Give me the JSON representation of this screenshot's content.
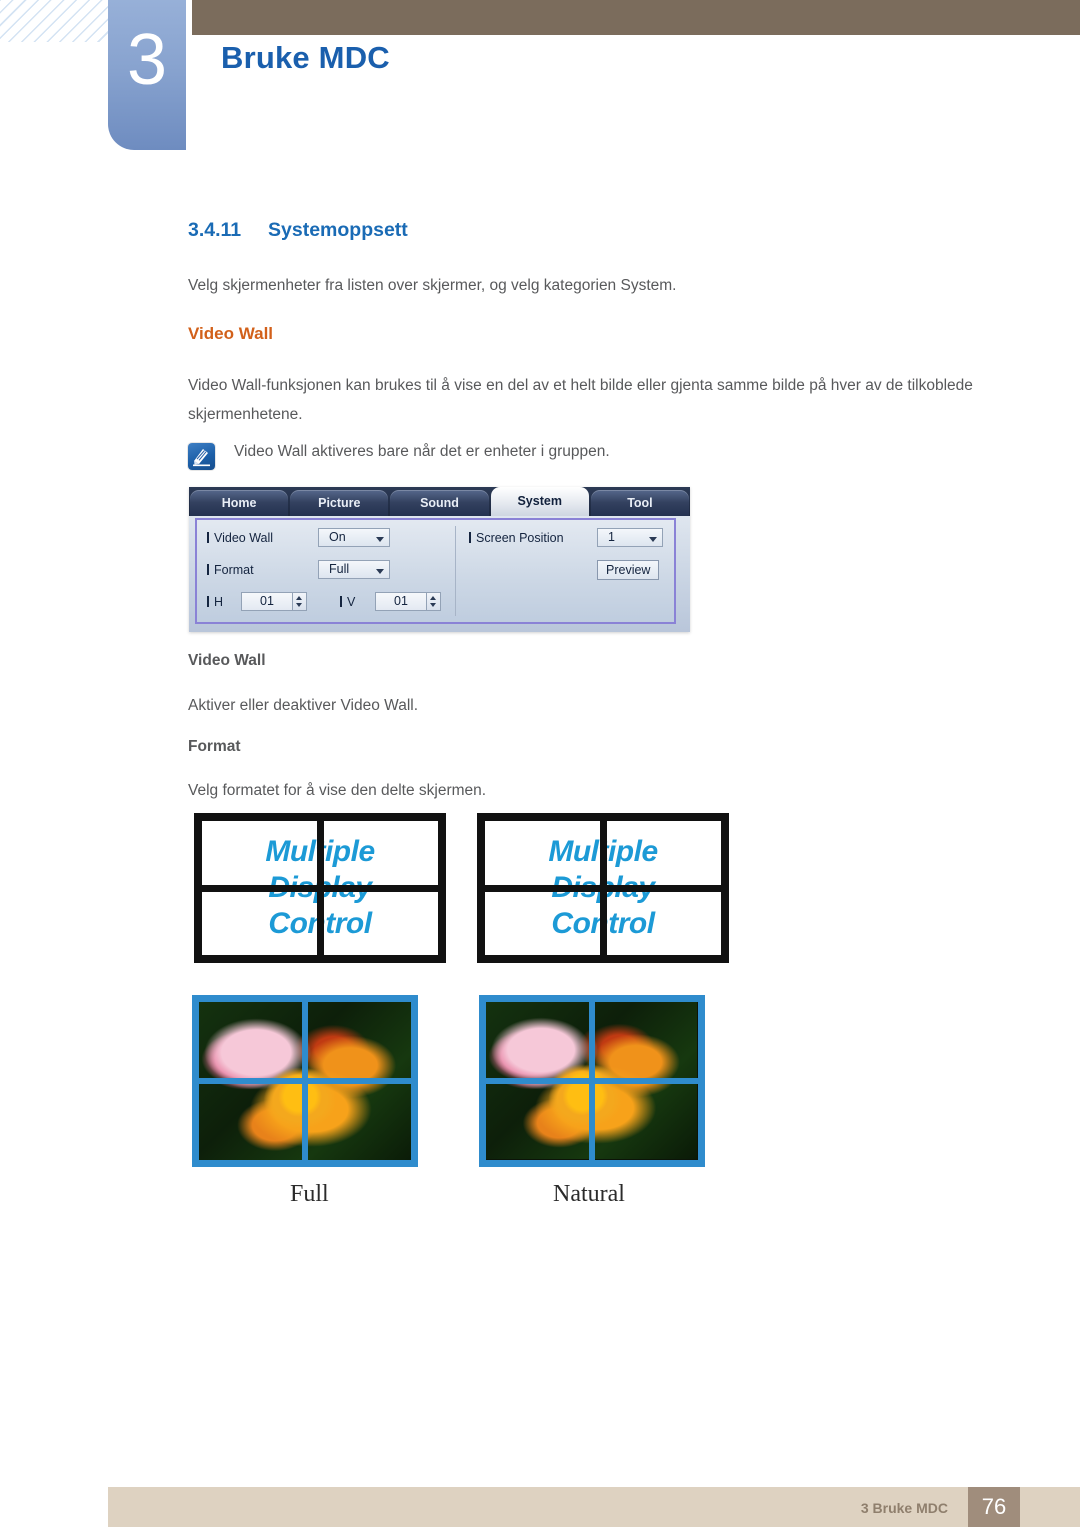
{
  "header": {
    "chapter_number": "3",
    "chapter_title": "Bruke MDC",
    "accent_blue": "#1a5fad",
    "bar_brown": "#7b6c5c"
  },
  "section": {
    "number": "3.4.11",
    "title": "Systemoppsett",
    "intro": "Velg skjermenheter fra listen over skjermer, og velg kategorien System."
  },
  "video_wall": {
    "heading": "Video Wall",
    "heading_color": "#d2601a",
    "description": "Video Wall-funksjonen kan brukes til å vise en del av et helt bilde eller gjenta samme bilde på hver av de tilkoblede skjermenhetene.",
    "note_icon": "note-pen-icon",
    "note": "Video Wall aktiveres bare når det er enheter i gruppen."
  },
  "mdc_panel": {
    "tabs": [
      {
        "label": "Home",
        "active": false
      },
      {
        "label": "Picture",
        "active": false
      },
      {
        "label": "Sound",
        "active": false
      },
      {
        "label": "System",
        "active": true
      },
      {
        "label": "Tool",
        "active": false
      }
    ],
    "left_column": {
      "video_wall_label": "Video Wall",
      "video_wall_value": "On",
      "format_label": "Format",
      "format_value": "Full",
      "h_label": "H",
      "h_value": "01",
      "v_label": "V",
      "v_value": "01"
    },
    "right_column": {
      "screen_position_label": "Screen Position",
      "screen_position_value": "1",
      "preview_button": "Preview"
    },
    "frame_color": "#8a82d6"
  },
  "descriptions": [
    {
      "title": "Video Wall",
      "text": "Aktiver eller deaktiver Video Wall."
    },
    {
      "title": "Format",
      "text": "Velg formatet for å vise den delte skjermen."
    }
  ],
  "wall_diagrams": [
    {
      "line1": "Multiple",
      "line2": "Display",
      "line3": "Control",
      "text_color": "#1c9ad6"
    },
    {
      "line1": "Multiple",
      "line2": "Display",
      "line3": "Control",
      "text_color": "#1c9ad6"
    }
  ],
  "format_examples": [
    {
      "caption": "Full",
      "border_color": "#2f8ccd"
    },
    {
      "caption": "Natural",
      "border_color": "#2f8ccd"
    }
  ],
  "footer": {
    "text": "3 Bruke MDC",
    "page_number": "76",
    "bar_color": "#ded2c1",
    "page_box_color": "#a08d7c"
  }
}
